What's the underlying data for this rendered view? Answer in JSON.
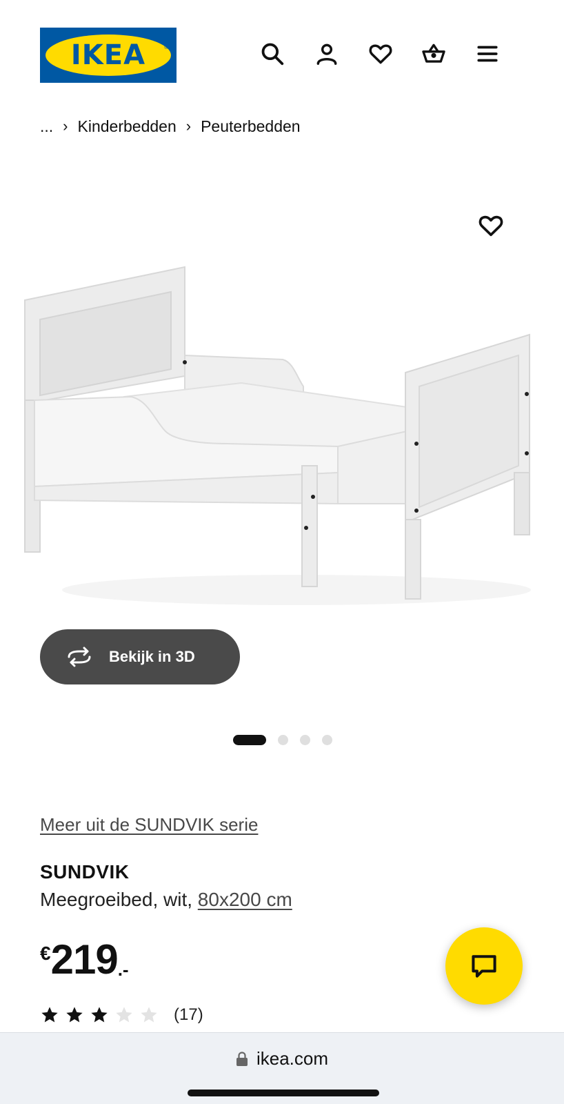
{
  "header": {
    "logo_text": "IKEA",
    "logo_reg": "®",
    "icons": [
      "search-icon",
      "user-icon",
      "heart-icon",
      "basket-icon",
      "menu-icon"
    ],
    "brand_blue": "#0058a3",
    "brand_yellow": "#ffdb00"
  },
  "breadcrumb": {
    "ellipsis": "...",
    "items": [
      "Kinderbedden",
      "Peuterbedden"
    ]
  },
  "gallery": {
    "view_3d_label": "Bekijk in 3D",
    "slide_count": 4,
    "active_slide": 1
  },
  "product": {
    "series_link": "Meer uit de SUNDVIK serie",
    "name": "SUNDVIK",
    "description_prefix": "Meegroeibed, wit, ",
    "size_link": "80x200 cm",
    "price_currency": "€",
    "price_integer": "219",
    "price_decimal": ".-",
    "rating_stars": 3,
    "rating_max": 5,
    "review_count": "(17)"
  },
  "browser": {
    "url": "ikea.com"
  }
}
